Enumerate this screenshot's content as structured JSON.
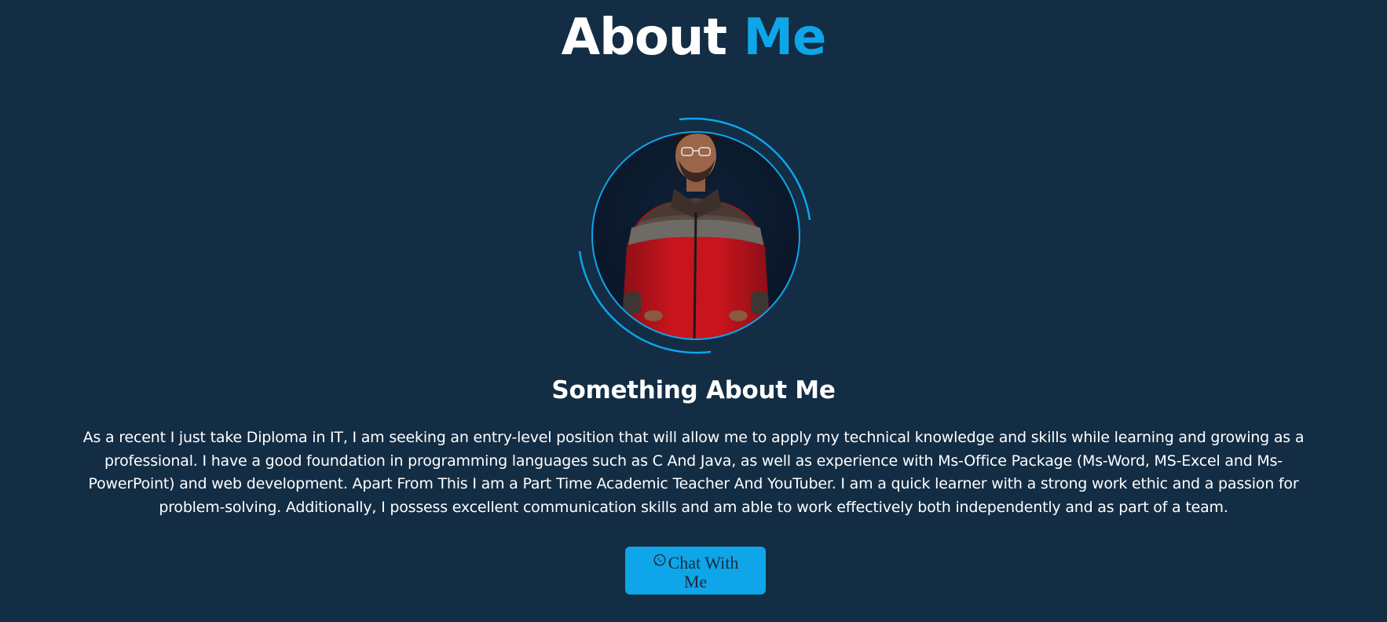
{
  "header": {
    "title_part1": "About ",
    "title_part2": "Me"
  },
  "profile": {
    "photo_alt": "Profile photo"
  },
  "about": {
    "subheading": "Something About Me",
    "paragraph": "As a recent I just take Diploma in IT, I am seeking an entry-level position that will allow me to apply my technical knowledge and skills while learning and growing as a professional. I have a good foundation in programming languages such as C And Java, as well as experience with Ms-Office Package (Ms-Word, MS-Excel and Ms- PowerPoint) and web development. Apart From This I am a Part Time Academic Teacher And YouTuber. I am a quick learner with a strong work ethic and a passion for problem-solving. Additionally, I possess excellent communication skills and am able to work effectively both independently and as part of a team."
  },
  "cta": {
    "label": "Chat  With Me",
    "icon": "whatsapp-icon"
  },
  "colors": {
    "background": "#132d44",
    "accent": "#0ea5e9",
    "text": "#ffffff"
  }
}
